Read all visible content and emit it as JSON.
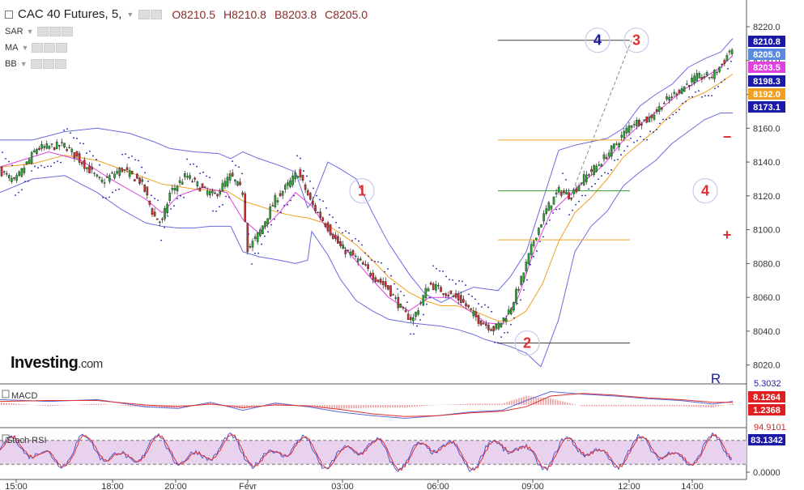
{
  "header": {
    "symbol": "CAC 40 Futures, 5,",
    "open": "O8210.5",
    "high": "H8210.8",
    "low": "B8203.8",
    "close": "C8205.0"
  },
  "indicators": [
    "SAR",
    "MA",
    "BB"
  ],
  "logo": {
    "main": "Investing",
    "suffix": ".com"
  },
  "chart_data": {
    "type": "candlestick",
    "x_ticks": [
      "15:00",
      "18:00",
      "20:00",
      "Févr",
      "03:00",
      "06:00",
      "09:00",
      "12:00",
      "14:00"
    ],
    "y_ticks": [
      "8220.0",
      "8200.0",
      "8180.0",
      "8160.0",
      "8140.0",
      "8120.0",
      "8100.0",
      "8080.0",
      "8060.0",
      "8040.0",
      "8020.0"
    ],
    "ylim": [
      8011,
      8226
    ],
    "grid": false,
    "price_badges": [
      {
        "text": "8210.8",
        "color": "#1a1aa6",
        "value": 8210.8
      },
      {
        "text": "8205.0",
        "color": "#5a8ae0",
        "value": 8205.0
      },
      {
        "text": "8203.5",
        "color": "#e040e0",
        "value": 8203.5
      },
      {
        "text": "8198.3",
        "color": "#1a1aa6",
        "value": 8198.3
      },
      {
        "text": "8192.0",
        "color": "#f0a020",
        "value": 8192.0
      },
      {
        "text": "8173.1",
        "color": "#1a1aa6",
        "value": 8173.1
      }
    ],
    "path_keys": [
      [
        0,
        8135
      ],
      [
        18,
        8128
      ],
      [
        45,
        8148
      ],
      [
        80,
        8150
      ],
      [
        105,
        8138
      ],
      [
        125,
        8128
      ],
      [
        150,
        8136
      ],
      [
        175,
        8128
      ],
      [
        190,
        8108
      ],
      [
        200,
        8104
      ],
      [
        210,
        8122
      ],
      [
        230,
        8132
      ],
      [
        250,
        8124
      ],
      [
        265,
        8120
      ],
      [
        285,
        8132
      ],
      [
        300,
        8122
      ],
      [
        306,
        8088
      ],
      [
        320,
        8098
      ],
      [
        340,
        8118
      ],
      [
        355,
        8126
      ],
      [
        368,
        8134
      ],
      [
        385,
        8115
      ],
      [
        400,
        8105
      ],
      [
        420,
        8090
      ],
      [
        440,
        8083
      ],
      [
        460,
        8073
      ],
      [
        480,
        8065
      ],
      [
        500,
        8050
      ],
      [
        510,
        8047
      ],
      [
        530,
        8068
      ],
      [
        550,
        8063
      ],
      [
        570,
        8058
      ],
      [
        590,
        8047
      ],
      [
        610,
        8041
      ],
      [
        620,
        8046
      ],
      [
        630,
        8053
      ],
      [
        645,
        8072
      ],
      [
        660,
        8095
      ],
      [
        675,
        8112
      ],
      [
        690,
        8123
      ],
      [
        705,
        8120
      ],
      [
        720,
        8130
      ],
      [
        740,
        8139
      ],
      [
        760,
        8150
      ],
      [
        780,
        8163
      ],
      [
        800,
        8165
      ],
      [
        820,
        8175
      ],
      [
        840,
        8183
      ],
      [
        860,
        8190
      ],
      [
        880,
        8191
      ],
      [
        895,
        8200
      ],
      [
        903,
        8208
      ],
      [
        905,
        8205
      ]
    ],
    "bb_upper": [
      [
        0,
        8153
      ],
      [
        40,
        8153
      ],
      [
        80,
        8158
      ],
      [
        120,
        8160
      ],
      [
        160,
        8157
      ],
      [
        190,
        8152
      ],
      [
        210,
        8148
      ],
      [
        240,
        8146
      ],
      [
        270,
        8145
      ],
      [
        285,
        8142
      ],
      [
        300,
        8146
      ],
      [
        320,
        8142
      ],
      [
        345,
        8138
      ],
      [
        365,
        8134
      ],
      [
        380,
        8113
      ],
      [
        385,
        8116
      ],
      [
        405,
        8140
      ],
      [
        420,
        8136
      ],
      [
        440,
        8130
      ],
      [
        460,
        8110
      ],
      [
        480,
        8092
      ],
      [
        505,
        8074
      ],
      [
        525,
        8062
      ],
      [
        545,
        8057
      ],
      [
        565,
        8062
      ],
      [
        585,
        8066
      ],
      [
        600,
        8065
      ],
      [
        615,
        8064
      ],
      [
        630,
        8072
      ],
      [
        650,
        8087
      ],
      [
        670,
        8117
      ],
      [
        690,
        8147
      ],
      [
        710,
        8150
      ],
      [
        730,
        8152
      ],
      [
        750,
        8154
      ],
      [
        770,
        8160
      ],
      [
        790,
        8173
      ],
      [
        810,
        8180
      ],
      [
        830,
        8186
      ],
      [
        850,
        8196
      ],
      [
        870,
        8201
      ],
      [
        890,
        8205
      ],
      [
        905,
        8213
      ]
    ],
    "bb_lower": [
      [
        0,
        8122
      ],
      [
        40,
        8130
      ],
      [
        80,
        8132
      ],
      [
        120,
        8122
      ],
      [
        150,
        8112
      ],
      [
        180,
        8104
      ],
      [
        200,
        8102
      ],
      [
        220,
        8101
      ],
      [
        240,
        8101
      ],
      [
        260,
        8102
      ],
      [
        285,
        8102
      ],
      [
        300,
        8087
      ],
      [
        320,
        8084
      ],
      [
        345,
        8082
      ],
      [
        365,
        8080
      ],
      [
        380,
        8082
      ],
      [
        385,
        8099
      ],
      [
        405,
        8085
      ],
      [
        420,
        8071
      ],
      [
        440,
        8058
      ],
      [
        460,
        8052
      ],
      [
        480,
        8047
      ],
      [
        505,
        8045
      ],
      [
        525,
        8044
      ],
      [
        545,
        8043
      ],
      [
        565,
        8041
      ],
      [
        585,
        8038
      ],
      [
        600,
        8035
      ],
      [
        615,
        8033
      ],
      [
        630,
        8031
      ],
      [
        650,
        8027
      ],
      [
        668,
        8019
      ],
      [
        690,
        8047
      ],
      [
        710,
        8087
      ],
      [
        730,
        8102
      ],
      [
        750,
        8111
      ],
      [
        770,
        8126
      ],
      [
        790,
        8134
      ],
      [
        810,
        8141
      ],
      [
        830,
        8151
      ],
      [
        850,
        8158
      ],
      [
        870,
        8165
      ],
      [
        890,
        8169
      ],
      [
        905,
        8169
      ]
    ],
    "ma": [
      [
        0,
        8137
      ],
      [
        40,
        8139
      ],
      [
        80,
        8144
      ],
      [
        120,
        8141
      ],
      [
        160,
        8134
      ],
      [
        200,
        8127
      ],
      [
        240,
        8124
      ],
      [
        280,
        8123
      ],
      [
        300,
        8117
      ],
      [
        320,
        8114
      ],
      [
        345,
        8110
      ],
      [
        365,
        8108
      ],
      [
        380,
        8107
      ],
      [
        400,
        8104
      ],
      [
        420,
        8098
      ],
      [
        440,
        8091
      ],
      [
        460,
        8082
      ],
      [
        480,
        8072
      ],
      [
        505,
        8063
      ],
      [
        525,
        8058
      ],
      [
        545,
        8055
      ],
      [
        565,
        8055
      ],
      [
        585,
        8052
      ],
      [
        600,
        8049
      ],
      [
        615,
        8046
      ],
      [
        630,
        8046
      ],
      [
        650,
        8052
      ],
      [
        670,
        8068
      ],
      [
        690,
        8093
      ],
      [
        710,
        8110
      ],
      [
        730,
        8119
      ],
      [
        750,
        8130
      ],
      [
        770,
        8143
      ],
      [
        790,
        8151
      ],
      [
        810,
        8159
      ],
      [
        830,
        8169
      ],
      [
        850,
        8177
      ],
      [
        870,
        8181
      ],
      [
        890,
        8187
      ],
      [
        905,
        8192
      ]
    ],
    "ma2": [
      [
        0,
        8137
      ],
      [
        60,
        8146
      ],
      [
        100,
        8141
      ],
      [
        140,
        8129
      ],
      [
        180,
        8118
      ],
      [
        200,
        8110
      ],
      [
        220,
        8120
      ],
      [
        250,
        8125
      ],
      [
        280,
        8122
      ],
      [
        300,
        8106
      ],
      [
        320,
        8098
      ],
      [
        345,
        8110
      ],
      [
        365,
        8122
      ],
      [
        385,
        8114
      ],
      [
        405,
        8100
      ],
      [
        430,
        8087
      ],
      [
        455,
        8073
      ],
      [
        480,
        8060
      ],
      [
        505,
        8052
      ],
      [
        530,
        8060
      ],
      [
        555,
        8060
      ],
      [
        580,
        8052
      ],
      [
        600,
        8045
      ],
      [
        620,
        8044
      ],
      [
        640,
        8060
      ],
      [
        660,
        8088
      ],
      [
        680,
        8110
      ],
      [
        700,
        8119
      ],
      [
        720,
        8128
      ],
      [
        745,
        8138
      ],
      [
        770,
        8153
      ],
      [
        795,
        8164
      ],
      [
        820,
        8173
      ],
      [
        845,
        8183
      ],
      [
        870,
        8190
      ],
      [
        890,
        8196
      ],
      [
        905,
        8203
      ]
    ],
    "fib_lines": [
      {
        "value": 8212,
        "color": "#444444",
        "x0": 615,
        "x1": 778
      },
      {
        "value": 8153,
        "color": "#f0a020",
        "x0": 615,
        "x1": 778
      },
      {
        "value": 8123,
        "color": "#2ca02c",
        "x0": 615,
        "x1": 778
      },
      {
        "value": 8094,
        "color": "#f0a020",
        "x0": 615,
        "x1": 778
      },
      {
        "value": 8033,
        "color": "#444444",
        "x0": 615,
        "x1": 778
      }
    ],
    "annotations": [
      {
        "text": "1",
        "value": 8123,
        "xp": 447,
        "color": "#e03030",
        "circle": true
      },
      {
        "text": "2",
        "value": 8033,
        "xp": 651,
        "color": "#e03030",
        "circle": true
      },
      {
        "text": "3",
        "value": 8212,
        "xp": 786,
        "color": "#e03030",
        "circle": true
      },
      {
        "text": "4",
        "value": 8212,
        "xp": 738,
        "color": "#1a1aa6",
        "circle": true
      },
      {
        "text": "4",
        "value": 8123,
        "xp": 871,
        "color": "#e03030",
        "circle": true
      },
      {
        "text": "−",
        "value": 8155,
        "xp": 898,
        "color": "#e03030",
        "circle": false
      },
      {
        "text": "+",
        "value": 8097,
        "xp": 898,
        "color": "#e03030",
        "circle": false
      }
    ],
    "macd": {
      "label": "MACD",
      "badges": [
        {
          "text": "8.1264",
          "color": "#e02020"
        },
        {
          "text": "1.2368",
          "color": "#e02020"
        }
      ],
      "partial_top": "5.3032",
      "macd_line": [
        [
          0,
          6
        ],
        [
          60,
          4
        ],
        [
          120,
          6
        ],
        [
          180,
          -2
        ],
        [
          220,
          -4
        ],
        [
          260,
          3
        ],
        [
          300,
          -6
        ],
        [
          340,
          2
        ],
        [
          380,
          -2
        ],
        [
          420,
          -8
        ],
        [
          460,
          -12
        ],
        [
          500,
          -15
        ],
        [
          540,
          -12
        ],
        [
          580,
          -8
        ],
        [
          620,
          -6
        ],
        [
          650,
          5
        ],
        [
          680,
          15
        ],
        [
          720,
          12
        ],
        [
          760,
          10
        ],
        [
          800,
          7
        ],
        [
          840,
          5
        ],
        [
          880,
          1
        ],
        [
          905,
          4
        ]
      ],
      "signal_line": [
        [
          0,
          4
        ],
        [
          60,
          5
        ],
        [
          120,
          5
        ],
        [
          180,
          0
        ],
        [
          220,
          -2
        ],
        [
          260,
          1
        ],
        [
          300,
          -3
        ],
        [
          340,
          0
        ],
        [
          380,
          -1
        ],
        [
          420,
          -5
        ],
        [
          460,
          -10
        ],
        [
          500,
          -13
        ],
        [
          540,
          -12
        ],
        [
          580,
          -9
        ],
        [
          620,
          -7
        ],
        [
          650,
          -2
        ],
        [
          680,
          10
        ],
        [
          720,
          13
        ],
        [
          760,
          11
        ],
        [
          800,
          8
        ],
        [
          840,
          6
        ],
        [
          880,
          3
        ],
        [
          905,
          3
        ]
      ]
    },
    "stoch": {
      "label": "Stoch RSI",
      "value_badge": {
        "text": "83.1342",
        "color": "#1a1aa6"
      },
      "partial_top": "94.9101",
      "ytick": "0.0000",
      "upper_band": 80,
      "lower_band": 20
    }
  }
}
